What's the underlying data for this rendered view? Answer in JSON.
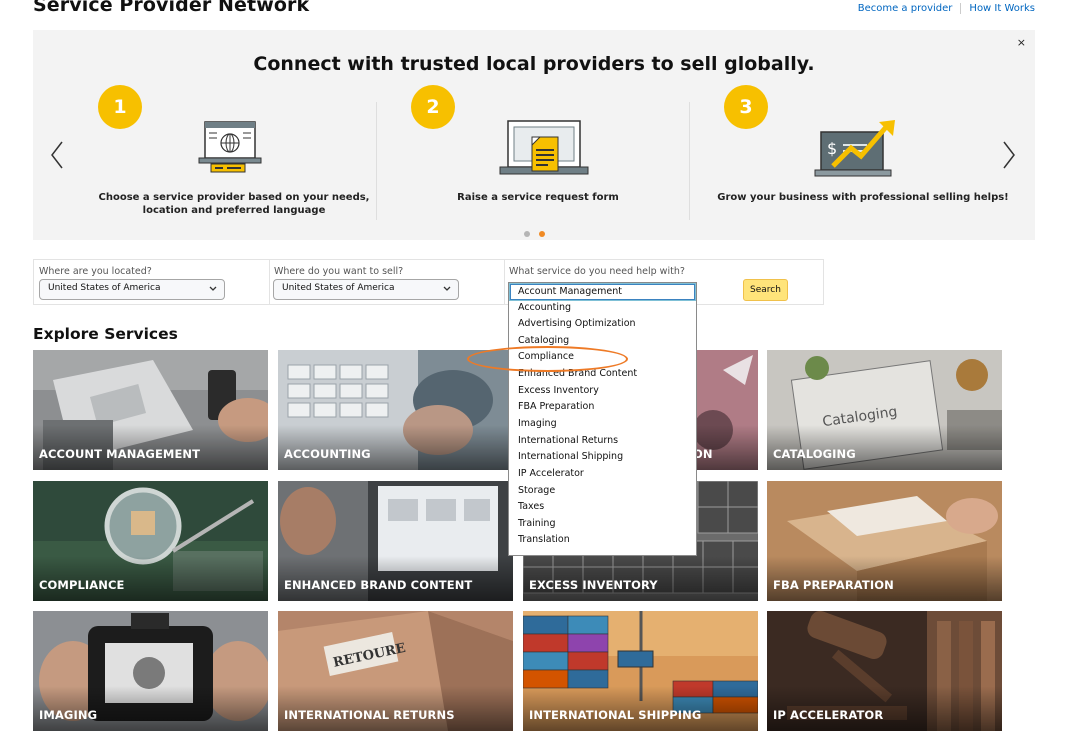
{
  "header": {
    "title": "Service Provider Network",
    "links": [
      "Become a provider",
      "How It Works"
    ]
  },
  "banner": {
    "title": "Connect with trusted local providers to sell globally.",
    "close": "×",
    "steps": [
      {
        "number": "1",
        "text": "Choose a service provider based on your needs, location and preferred language",
        "icon": "provider-browser-icon"
      },
      {
        "number": "2",
        "text": "Raise a service request form",
        "icon": "request-form-icon"
      },
      {
        "number": "3",
        "text": "Grow your business with professional selling helps!",
        "icon": "growth-laptop-icon"
      }
    ],
    "accent_color": "#f7c000"
  },
  "search": {
    "location_label": "Where are you located?",
    "location_value": "United States of America",
    "sell_label": "Where do you want to sell?",
    "sell_value": "United States of America",
    "service_label": "What service do you need help with?",
    "button_label": "Search"
  },
  "dropdown": {
    "selected": "Account Management",
    "options": [
      "Account Management",
      "Accounting",
      "Advertising Optimization",
      "Cataloging",
      "Compliance",
      "Enhanced Brand Content",
      "Excess Inventory",
      "FBA Preparation",
      "Imaging",
      "International Returns",
      "International Shipping",
      "IP Accelerator",
      "Storage",
      "Taxes",
      "Training",
      "Translation"
    ]
  },
  "explore": {
    "title": "Explore Services",
    "tiles": [
      "ACCOUNT MANAGEMENT",
      "ACCOUNTING",
      "ON",
      "CATALOGING",
      "COMPLIANCE",
      "ENHANCED BRAND CONTENT",
      "EXCESS INVENTORY",
      "FBA PREPARATION",
      "IMAGING",
      "INTERNATIONAL RETURNS",
      "INTERNATIONAL SHIPPING",
      "IP ACCELERATOR"
    ],
    "retoure_stamp": "RETOURE"
  }
}
